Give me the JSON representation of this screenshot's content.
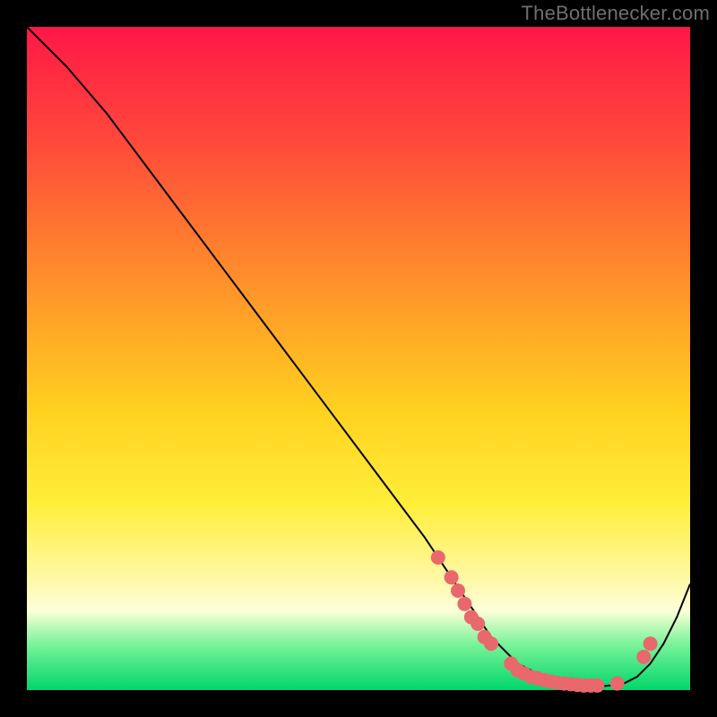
{
  "attribution": "TheBottlenecker.com",
  "colors": {
    "dot": "#e9686c",
    "curve": "#000000"
  },
  "chart_data": {
    "type": "line",
    "title": "",
    "xlabel": "",
    "ylabel": "",
    "xlim": [
      0,
      100
    ],
    "ylim": [
      0,
      100
    ],
    "grid": false,
    "legend": false,
    "series": [
      {
        "name": "curve",
        "x": [
          0,
          6,
          12,
          18,
          24,
          30,
          36,
          42,
          48,
          54,
          60,
          62,
          64,
          66,
          68,
          70,
          72,
          74,
          76,
          78,
          80,
          82,
          84,
          86,
          88,
          90,
          92,
          94,
          96,
          98,
          100
        ],
        "y": [
          100,
          94,
          87,
          79,
          71,
          63,
          55,
          47,
          39,
          31,
          23,
          20,
          17,
          14,
          11,
          8,
          6,
          4,
          3,
          2,
          1,
          0.7,
          0.5,
          0.5,
          0.7,
          1,
          2,
          4,
          7,
          11,
          16
        ]
      }
    ],
    "markers": [
      {
        "x": 62,
        "y": 20
      },
      {
        "x": 64,
        "y": 17
      },
      {
        "x": 65,
        "y": 15
      },
      {
        "x": 66,
        "y": 13
      },
      {
        "x": 67,
        "y": 11
      },
      {
        "x": 68,
        "y": 10
      },
      {
        "x": 69,
        "y": 8
      },
      {
        "x": 70,
        "y": 7
      },
      {
        "x": 73,
        "y": 4
      },
      {
        "x": 74,
        "y": 3
      },
      {
        "x": 75,
        "y": 2.5
      },
      {
        "x": 76,
        "y": 2
      },
      {
        "x": 77,
        "y": 1.8
      },
      {
        "x": 78,
        "y": 1.5
      },
      {
        "x": 79,
        "y": 1.3
      },
      {
        "x": 80,
        "y": 1.1
      },
      {
        "x": 81,
        "y": 1.0
      },
      {
        "x": 82,
        "y": 0.9
      },
      {
        "x": 83,
        "y": 0.8
      },
      {
        "x": 84,
        "y": 0.7
      },
      {
        "x": 85,
        "y": 0.7
      },
      {
        "x": 86,
        "y": 0.7
      },
      {
        "x": 89,
        "y": 1.0
      },
      {
        "x": 93,
        "y": 5
      },
      {
        "x": 94,
        "y": 7
      }
    ]
  }
}
